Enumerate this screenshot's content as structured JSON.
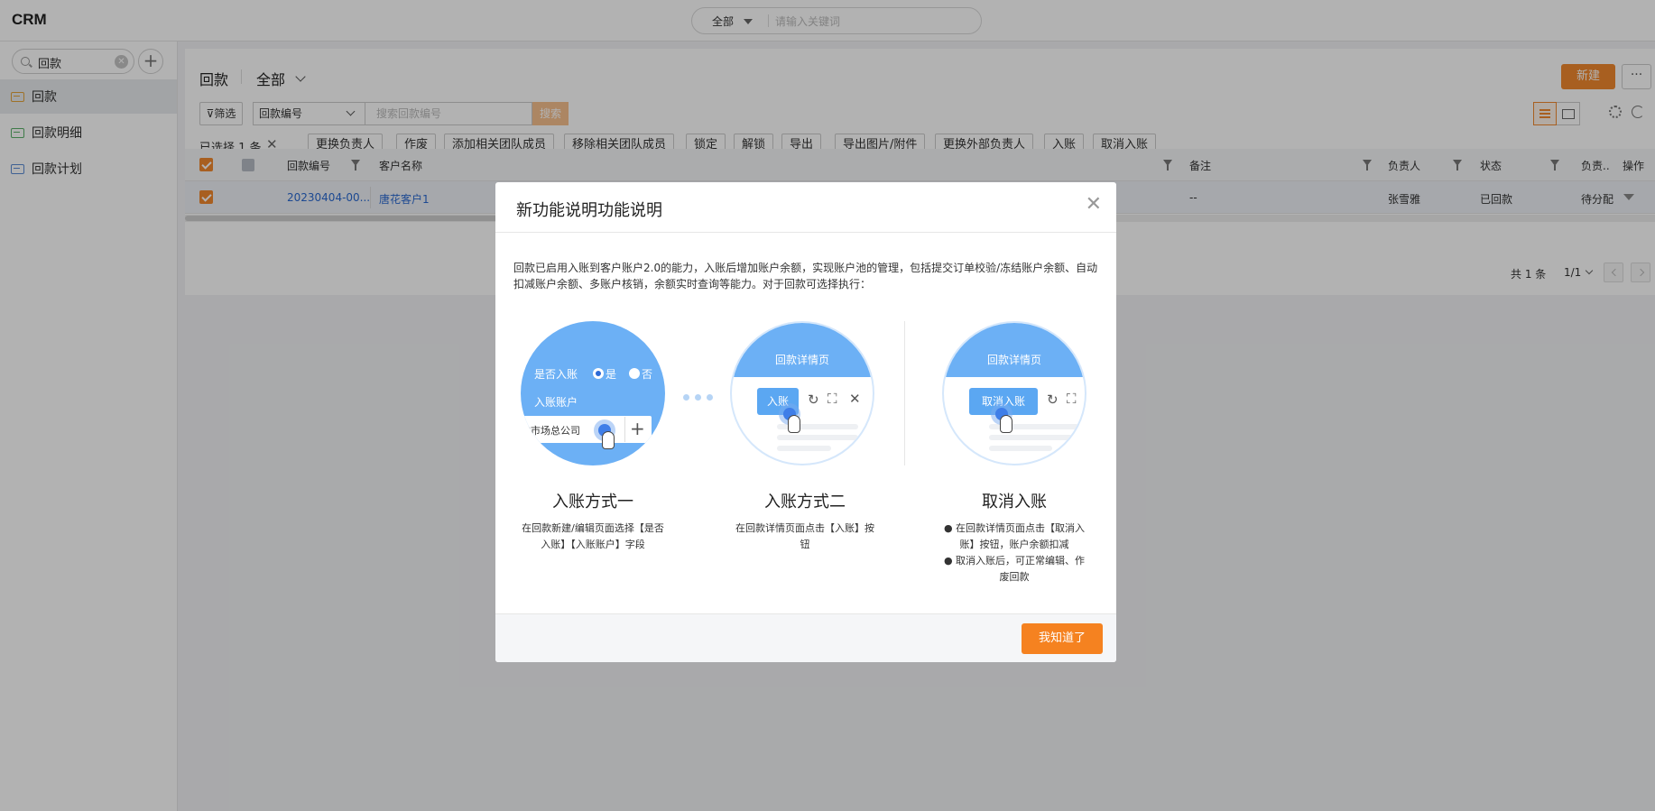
{
  "app": {
    "title": "CRM"
  },
  "global_search": {
    "scope": "全部",
    "placeholder": "请输入关键词"
  },
  "sidebar": {
    "search_value": "回款",
    "items": [
      {
        "label": "回款",
        "active": true
      },
      {
        "label": "回款明细"
      },
      {
        "label": "回款计划"
      }
    ]
  },
  "header": {
    "title": "回款",
    "scope": "全部",
    "new_label": "新建",
    "more_label": "···"
  },
  "filters": {
    "filter_label": "筛选",
    "field": "回款编号",
    "placeholder": "搜索回款编号",
    "search_label": "搜索"
  },
  "selection": {
    "text": "已选择 1 条"
  },
  "bulk_actions": [
    "更换负责人",
    "作废",
    "添加相关团队成员",
    "移除相关团队成员",
    "锁定",
    "解锁",
    "导出",
    "导出图片/附件",
    "更换外部负责人",
    "入账",
    "取消入账"
  ],
  "table": {
    "columns": [
      "回款编号",
      "客户名称",
      "备注",
      "负责人",
      "状态",
      "负责..",
      "操作"
    ],
    "rows": [
      {
        "no": "20230404-00...",
        "customer": "唐花客户1",
        "remark": "--",
        "owner": "张雪雅",
        "status": "已回款",
        "extra": "待分配"
      }
    ]
  },
  "pager": {
    "total": "共 1 条",
    "page": "1/1"
  },
  "modal": {
    "title": "新功能说明功能说明",
    "description": "回款已启用入账到客户账户2.0的能力，入账后增加账户余额，实现账户池的管理，包括提交订单校验/冻结账户余额、自动扣减账户余额、多账户核销，余额实时查询等能力。对于回款可选择执行：",
    "ill1": {
      "question": "是否入账",
      "yes": "是",
      "no": "否",
      "account_label": "入账账户",
      "account_value": "发市场总公司"
    },
    "ill2": {
      "header": "回款详情页",
      "button": "入账"
    },
    "ill3": {
      "header": "回款详情页",
      "button": "取消入账"
    },
    "steps": [
      {
        "title": "入账方式一",
        "desc": "在回款新建/编辑页面选择【是否入账】【入账账户】字段"
      },
      {
        "title": "入账方式二",
        "desc": "在回款详情页面点击【入账】按钮"
      },
      {
        "title": "取消入账",
        "desc1": "● 在回款详情页面点击【取消入账】按钮，账户余额扣减",
        "desc2": "● 取消入账后，可正常编辑、作废回款"
      }
    ],
    "ok_label": "我知道了"
  },
  "colors": {
    "accent": "#f1892e",
    "link": "#2a69d1",
    "illustration_blue": "#6cb0f5"
  }
}
